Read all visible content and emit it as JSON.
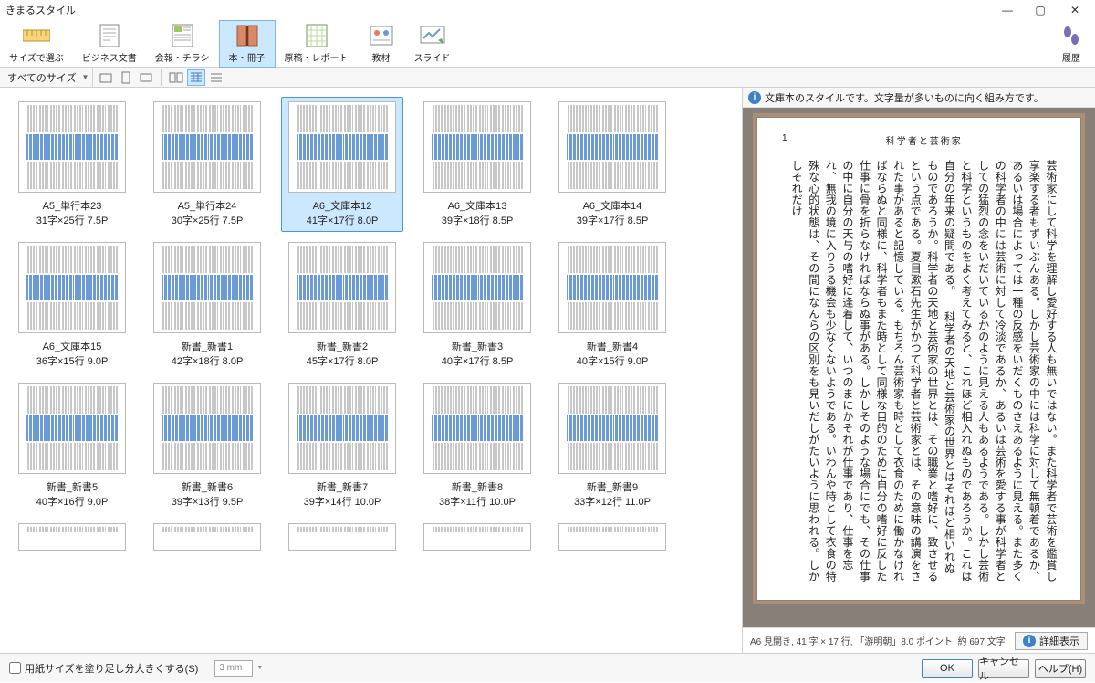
{
  "window": {
    "title": "きまるスタイル"
  },
  "toolbar": [
    {
      "label": "サイズで選ぶ"
    },
    {
      "label": "ビジネス文書"
    },
    {
      "label": "会報・チラシ"
    },
    {
      "label": "本・冊子"
    },
    {
      "label": "原稿・レポート"
    },
    {
      "label": "教材"
    },
    {
      "label": "スライド"
    }
  ],
  "toolbar_right": {
    "label": "履歴"
  },
  "size_filter": "すべてのサイズ",
  "preview_description": "文庫本のスタイルです。文字量が多いものに向く組み方です。",
  "cards": [
    {
      "name": "A5_単行本23",
      "spec": "31字×25行 7.5P"
    },
    {
      "name": "A5_単行本24",
      "spec": "30字×25行 7.5P"
    },
    {
      "name": "A6_文庫本12",
      "spec": "41字×17行 8.0P"
    },
    {
      "name": "A6_文庫本13",
      "spec": "39字×18行 8.5P"
    },
    {
      "name": "A6_文庫本14",
      "spec": "39字×17行 8.5P"
    },
    {
      "name": "A6_文庫本15",
      "spec": "36字×15行 9.0P"
    },
    {
      "name": "新書_新書1",
      "spec": "42字×18行 8.0P"
    },
    {
      "name": "新書_新書2",
      "spec": "45字×17行 8.0P"
    },
    {
      "name": "新書_新書3",
      "spec": "40字×17行 8.5P"
    },
    {
      "name": "新書_新書4",
      "spec": "40字×15行 9.0P"
    },
    {
      "name": "新書_新書5",
      "spec": "40字×16行 9.0P"
    },
    {
      "name": "新書_新書6",
      "spec": "39字×13行 9.5P"
    },
    {
      "name": "新書_新書7",
      "spec": "39字×14行 10.0P"
    },
    {
      "name": "新書_新書8",
      "spec": "38字×11行 10.0P"
    },
    {
      "name": "新書_新書9",
      "spec": "33字×12行 11.0P"
    }
  ],
  "preview": {
    "page_num": "1",
    "heading": "科学者と芸術家",
    "body": "芸術家にして科学を理解し愛好する人も無いではない。また科学者で芸術を鑑賞し享楽する者もずいぶんある。しかし芸術家の中には科学に対して無頓着であるか、あるいは場合によっては一種の反感をいだくものさえあるように見える。また多くの科学者の中には芸術に対して冷淡であるか、あるいは芸術を愛する事が科学者としての猛烈の念をいだいているかのように見える人もあるようである。しかし芸術と科学というものをよく考えてみると、これほど相入れぬものであろうか。これは自分の年来の疑問である。\n　科学者の天地と芸術家の世界とはそれほど相いれぬものであろうか。科学者の天地と芸術家の世界とは、その職業と嗜好に、致させるという点である。夏目漱石先生がかつて科学者と芸術家とは、その意味の講演をされた事があると記憶している。もちろん芸術家も時として衣食のために働かなければならぬと同様に、科学者もまた時として同様な目的のために自分の嗜好に反した仕事に骨を折らなければならぬ事がある。しかしそのような場合にでも、その仕事の中に自分の天与の嗜好に逢着して、いつのまにかそれが仕事であり、仕事を忘れ、無我の境に入りうる機会も少なくないようである。いわんや時として衣食の特殊な心的状態は、その間になんらの区別をも見いだしがたいように思われる。しかしそれだけ",
    "meta": "A6 見開き,  41 字 × 17 行, 「游明朝」8.0 ポイント,  約 697 文字",
    "detail_btn": "詳細表示"
  },
  "bottom": {
    "bleed_label": "用紙サイズを塗り足し分大きくする(S)",
    "bleed_value": "3 mm",
    "ok": "OK",
    "cancel": "キャンセル",
    "help": "ヘルプ(H)"
  }
}
